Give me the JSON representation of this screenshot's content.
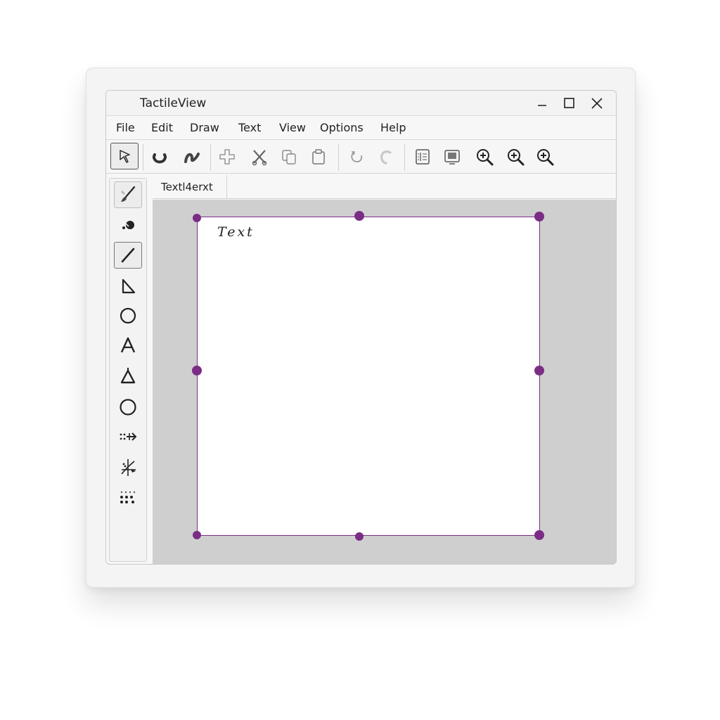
{
  "window": {
    "title": "TactileView"
  },
  "menu": [
    "File",
    "Edit",
    "Draw",
    "Text",
    "View",
    "Options",
    "Help"
  ],
  "toolbar": {
    "icons": [
      "pointer-icon",
      "rotate-icon",
      "curve-icon",
      "add-icon",
      "cut-icon",
      "copy-icon",
      "paste-icon",
      "undo-icon",
      "redo-icon",
      "layers-icon",
      "preview-icon",
      "zoom-in-icon",
      "zoom-in-icon",
      "zoom-in-icon"
    ]
  },
  "document_tab": {
    "label": "Textl4erxt"
  },
  "canvas": {
    "text": "Text"
  },
  "colors": {
    "accent": "#7b2d86",
    "workspace": "#cfcfcf"
  }
}
